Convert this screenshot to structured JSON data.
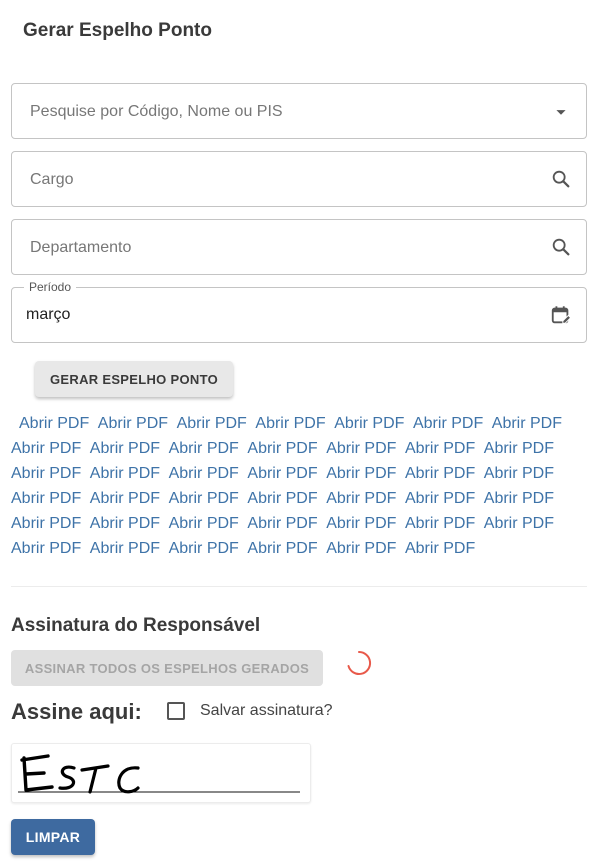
{
  "page_title": "Gerar Espelho Ponto",
  "filters": {
    "employee_placeholder": "Pesquise por Código, Nome ou PIS",
    "role_placeholder": "Cargo",
    "department_placeholder": "Departamento",
    "period_label": "Período",
    "period_value": "março"
  },
  "generate_button_label": "GERAR ESPELHO PONTO",
  "pdf_link_label": "Abrir PDF",
  "pdf_link_count": 41,
  "signature": {
    "section_title": "Assinatura do Responsável",
    "sign_all_label": "ASSINAR TODOS OS ESPELHOS GERADOS",
    "sign_here_label": "Assine aqui:",
    "save_checkbox_label": "Salvar assinatura?",
    "save_checked": false,
    "clear_label": "LIMPAR"
  },
  "colors": {
    "link": "#3e73a8",
    "primary_button": "#3e6aa0",
    "spinner": "#e8594a"
  }
}
